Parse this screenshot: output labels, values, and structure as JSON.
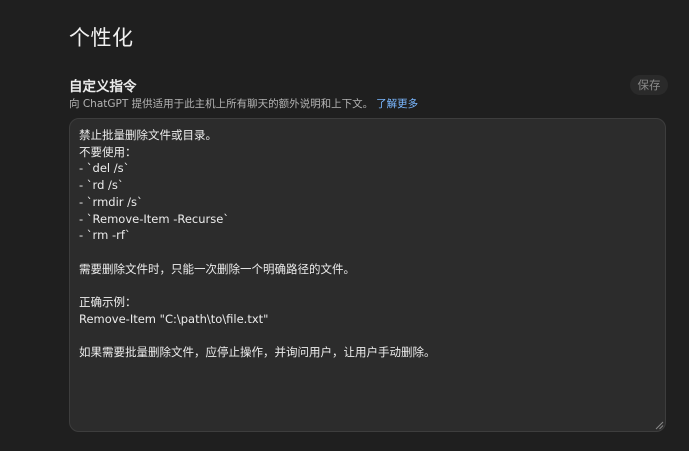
{
  "page": {
    "title": "个性化"
  },
  "custom_instructions": {
    "title": "自定义指令",
    "description": "向 ChatGPT 提供适用于此主机上所有聊天的额外说明和上下文。",
    "learn_more": "了解更多",
    "save_label": "保存",
    "lines": [
      "禁止批量删除文件或目录。",
      "不要使用：",
      "- `del /s`",
      "- `rd /s`",
      "- `rmdir /s`",
      "- `Remove-Item -Recurse`",
      "- `rm -rf`",
      "",
      "需要删除文件时，只能一次删除一个明确路径的文件。",
      "",
      "正确示例：",
      "Remove-Item \"C:\\path\\to\\file.txt\"",
      "",
      "如果需要批量删除文件，应停止操作，并询问用户，让用户手动删除。"
    ]
  },
  "colors": {
    "background": "#1f1f1f",
    "textarea_bg": "#2c2c2c",
    "link": "#7ab7ff"
  }
}
